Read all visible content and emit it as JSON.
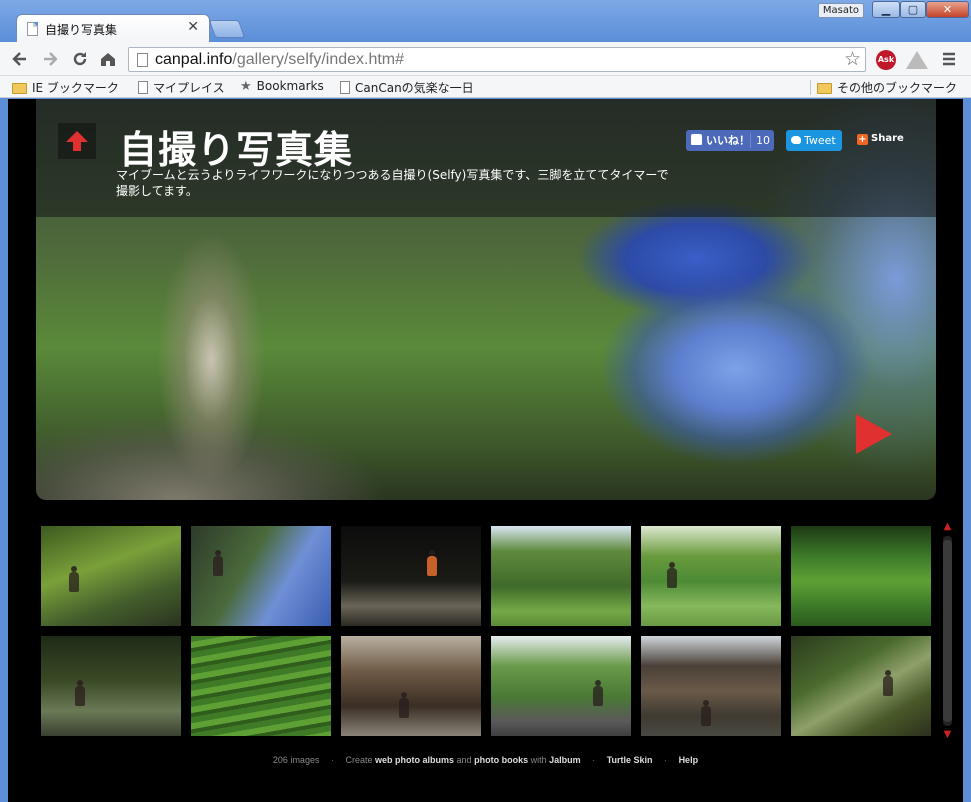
{
  "window": {
    "tab_title": "自撮り写真集",
    "tab_close": "✕",
    "user": "Masato",
    "controls": {
      "minimize": "▁",
      "maximize": "▢",
      "close": "✕"
    }
  },
  "toolbar": {
    "url_host": "canpal.info",
    "url_path": "/gallery/selfy/index.htm#",
    "icons": [
      "back-icon",
      "forward-icon",
      "reload-icon",
      "home-icon",
      "page-icon",
      "bookmark-star-icon",
      "ask-extension-icon",
      "drive-extension-icon",
      "menu-icon"
    ],
    "ask_label": "Ask"
  },
  "bookmarks": {
    "items": [
      {
        "label": "IE ブックマーク",
        "icon": "folder-icon"
      },
      {
        "label": "マイプレイス",
        "icon": "page-icon"
      },
      {
        "label": "Bookmarks",
        "icon": "star-icon"
      },
      {
        "label": "CanCanの気楽な一日",
        "icon": "page-icon"
      }
    ],
    "other": {
      "label": "その他のブックマーク",
      "icon": "folder-icon"
    }
  },
  "album": {
    "title": "自撮り写真集",
    "description": "マイブームと云うよりライフワークになりつつある自撮り(Selfy)写真集です、三脚を立ててタイマーで撮影してます。",
    "social": {
      "like_label": "いいね！",
      "like_count": "10",
      "tweet_label": "Tweet",
      "share_label": "Share"
    },
    "colors": {
      "accent_red": "#e03030",
      "facebook": "#4c69ba",
      "twitter": "#1b95e0"
    }
  },
  "thumbnails": {
    "count_visible": 12,
    "rows": [
      [
        "bg1",
        "bg2",
        "bg3",
        "bg4",
        "bg5",
        "bg6"
      ],
      [
        "bg7",
        "bg8",
        "bg9",
        "bg10",
        "bg11",
        "bg12"
      ]
    ]
  },
  "footer": {
    "count": "206 images",
    "create": "Create",
    "web_albums": "web photo albums",
    "and": "and",
    "books": "photo books",
    "with": "with",
    "jalbum": "Jalbum",
    "skin": "Turtle Skin",
    "help": "Help",
    "dot": "·"
  }
}
